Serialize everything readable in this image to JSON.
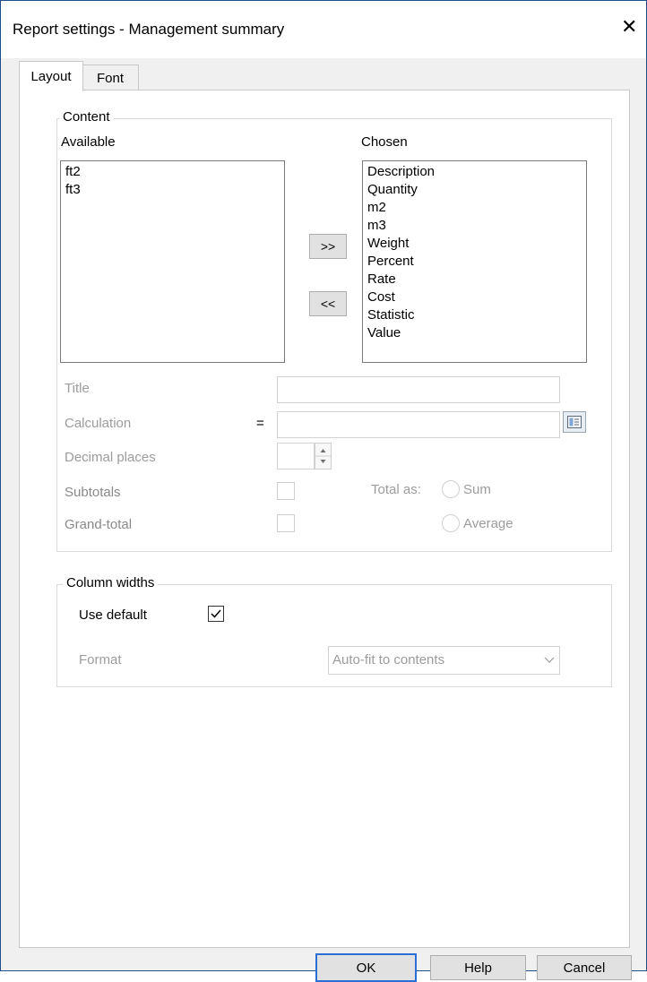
{
  "window": {
    "title": "Report settings - Management summary",
    "close_glyph": "✕"
  },
  "tabs": [
    {
      "label": "Layout"
    },
    {
      "label": "Font"
    }
  ],
  "content": {
    "legend": "Content",
    "available_label": "Available",
    "chosen_label": "Chosen",
    "available_items": [
      "ft2",
      "ft3"
    ],
    "chosen_items": [
      "Description",
      "Quantity",
      "m2",
      "m3",
      "Weight",
      "Percent",
      "Rate",
      "Cost",
      "Statistic",
      "Value"
    ],
    "add_label": ">>",
    "remove_label": "<<",
    "title_label": "Title",
    "title_value": "",
    "calculation_label": "Calculation",
    "equals": "=",
    "calculation_value": "",
    "decimal_label": "Decimal places",
    "subtotals_label": "Subtotals",
    "grandtotal_label": "Grand-total",
    "total_as_label": "Total as:",
    "sum_label": "Sum",
    "average_label": "Average"
  },
  "column_widths": {
    "legend": "Column widths",
    "use_default_label": "Use default",
    "use_default_checked": true,
    "format_label": "Format",
    "format_value": "Auto-fit to contents"
  },
  "footer": {
    "ok_label": "OK",
    "help_label": "Help",
    "cancel_label": "Cancel"
  },
  "colors": {
    "accent": "#2a6fd6",
    "disabled_text": "#9c9c9c"
  }
}
